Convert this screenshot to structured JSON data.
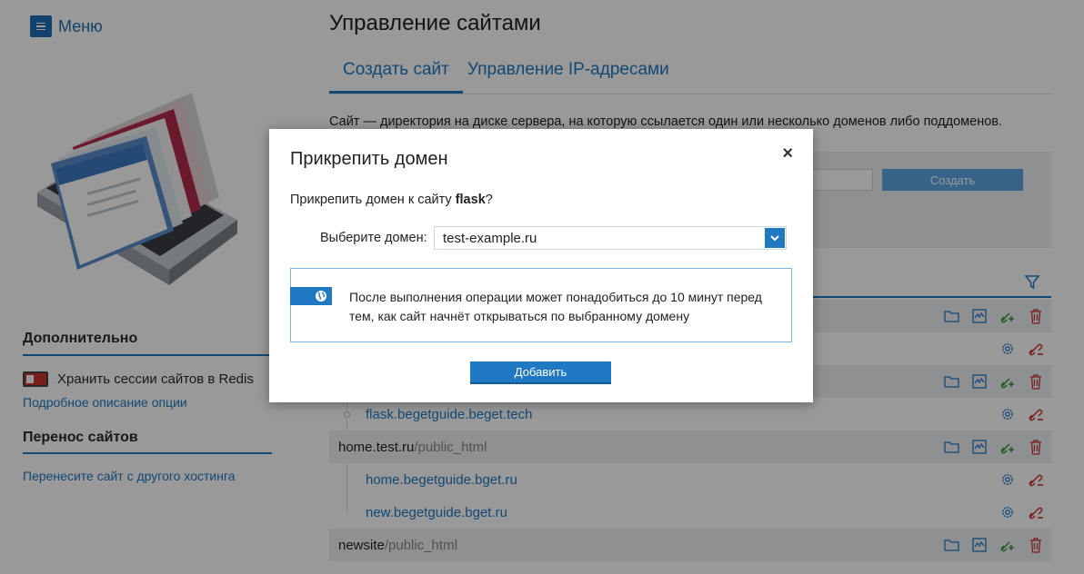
{
  "sidebar": {
    "menu_label": "Меню",
    "extra_title": "Дополнительно",
    "redis_label": "Хранить сессии сайтов в Redis",
    "redis_link": "Подробное описание опции",
    "transfer_title": "Перенос сайтов",
    "transfer_link": "Перенесите сайт с другого хостинга"
  },
  "main": {
    "title": "Управление сайтами",
    "tabs": [
      {
        "label": "Создать сайт",
        "active": true
      },
      {
        "label": "Управление IP-адресами",
        "active": false
      }
    ],
    "description": "Сайт — директория на диске сервера, на которую ссылается один или несколько доменов либо поддоменов.",
    "create_button": "Создать"
  },
  "sites": [
    {
      "name": "flask.begetguide.beget.tech",
      "type": "domain"
    },
    {
      "name": "home.test.ru",
      "path": "/public_html",
      "type": "dir"
    },
    {
      "name": "home.begetguide.bget.ru",
      "type": "domain"
    },
    {
      "name": "new.begetguide.bget.ru",
      "type": "domain"
    },
    {
      "name": "newsite",
      "path": "/public_html",
      "type": "dir"
    }
  ],
  "modal": {
    "title": "Прикрепить домен",
    "close": "×",
    "question_prefix": "Прикрепить домен к сайту ",
    "site_name": "flask",
    "question_suffix": "?",
    "select_label": "Выберите домен:",
    "select_value": "test-example.ru",
    "info_text": "После выполнения операции может понадобиться до 10 минут перед тем, как сайт начнёт открываться по выбранному домену",
    "add_button": "Добавить"
  },
  "colors": {
    "accent": "#1e78c2",
    "delete": "#cc3333",
    "add_green": "#3a9a3a"
  }
}
